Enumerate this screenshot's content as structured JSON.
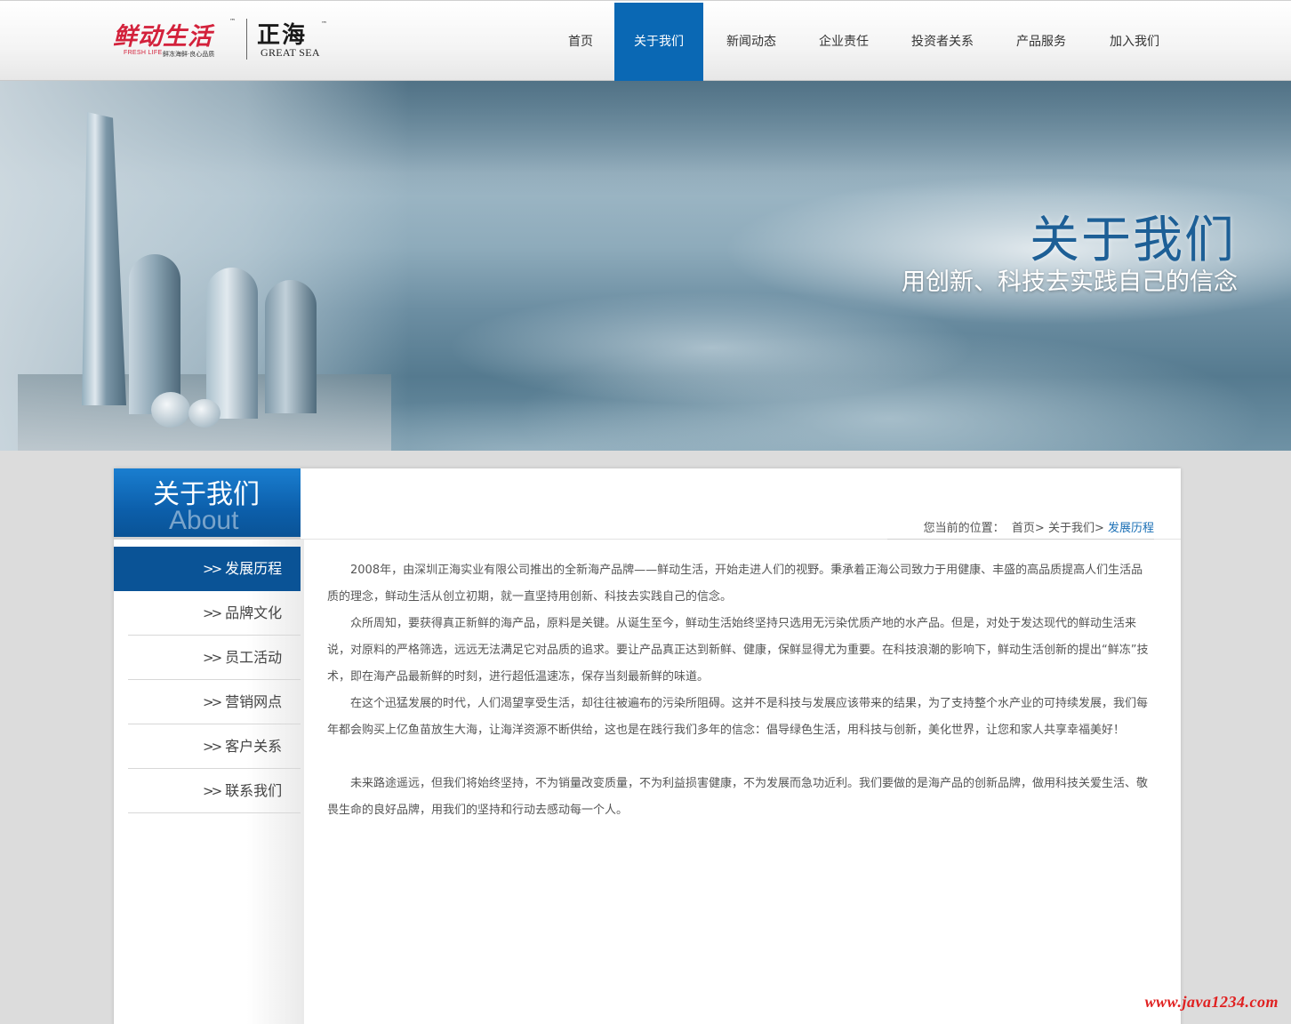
{
  "logo": {
    "brand_cn": "鲜动生活",
    "brand_tm": "™",
    "brand_sub_en": "FRESH LIFE",
    "brand_sub_cn": "鲜冻海鲜·良心品质",
    "company_cn": "正海",
    "company_tm": "™",
    "company_en": "GREAT SEA"
  },
  "nav": [
    {
      "label": "首页",
      "active": false
    },
    {
      "label": "关于我们",
      "active": true
    },
    {
      "label": "新闻动态",
      "active": false
    },
    {
      "label": "企业责任",
      "active": false
    },
    {
      "label": "投资者关系",
      "active": false
    },
    {
      "label": "产品服务",
      "active": false
    },
    {
      "label": "加入我们",
      "active": false
    }
  ],
  "banner": {
    "title": "关于我们",
    "subtitle": "用创新、科技去实践自己的信念"
  },
  "sidebar": {
    "title": "关于我们",
    "title_en": "About",
    "items": [
      {
        "label": "发展历程",
        "active": true
      },
      {
        "label": "品牌文化",
        "active": false
      },
      {
        "label": "员工活动",
        "active": false
      },
      {
        "label": "营销网点",
        "active": false
      },
      {
        "label": "客户关系",
        "active": false
      },
      {
        "label": "联系我们",
        "active": false
      }
    ]
  },
  "breadcrumb": {
    "prefix": "您当前的位置：",
    "items": [
      "首页>",
      "关于我们>",
      "发展历程"
    ]
  },
  "article": {
    "paragraphs": [
      "2008年，由深圳正海实业有限公司推出的全新海产品牌——鲜动生活，开始走进人们的视野。秉承着正海公司致力于用健康、丰盛的高品质提高人们生活品质的理念，鲜动生活从创立初期，就一直坚持用创新、科技去实践自己的信念。",
      "众所周知，要获得真正新鲜的海产品，原料是关键。从诞生至今，鲜动生活始终坚持只选用无污染优质产地的水产品。但是，对处于发达现代的鲜动生活来说，对原料的严格筛选，远远无法满足它对品质的追求。要让产品真正达到新鲜、健康，保鲜显得尤为重要。在科技浪潮的影响下，鲜动生活创新的提出“鲜冻”技术，即在海产品最新鲜的时刻，进行超低温速冻，保存当刻最新鲜的味道。",
      "在这个迅猛发展的时代，人们渴望享受生活，却往往被遍布的污染所阻碍。这并不是科技与发展应该带来的结果，为了支持整个水产业的可持续发展，我们每年都会购买上亿鱼苗放生大海，让海洋资源不断供给，这也是在践行我们多年的信念：倡导绿色生活，用科技与创新，美化世界，让您和家人共享幸福美好！",
      "未来路途遥远，但我们将始终坚持，不为销量改变质量，不为利益损害健康，不为发展而急功近利。我们要做的是海产品的创新品牌，做用科技关爱生活、敬畏生命的良好品牌，用我们的坚持和行动去感动每一个人。"
    ]
  },
  "watermark": "www.java1234.com",
  "colors": {
    "accent": "#0a68b4",
    "sidebar_active": "#0a5396",
    "brand_red": "#d3213b",
    "watermark_red": "#e02020"
  }
}
